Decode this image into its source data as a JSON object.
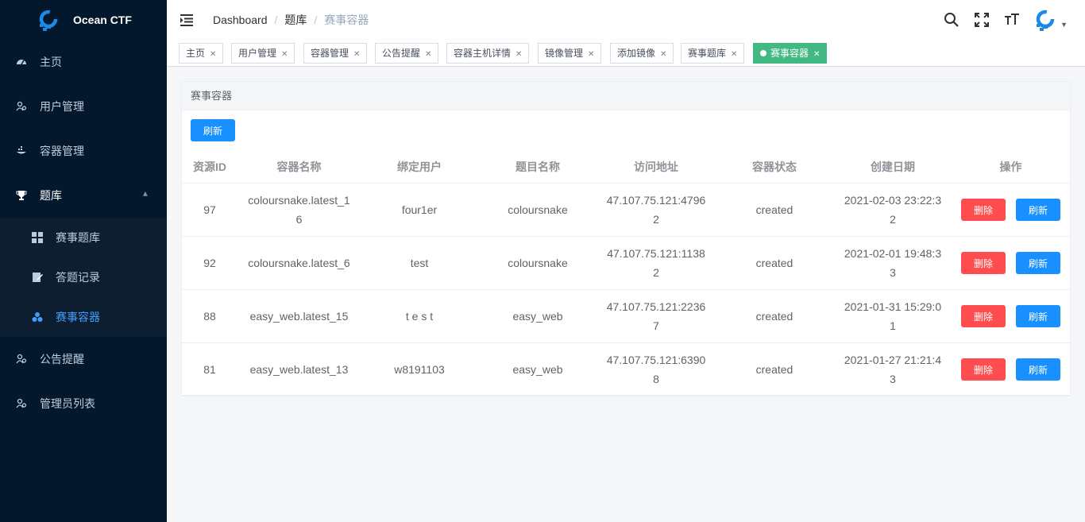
{
  "app": {
    "title": "Ocean CTF"
  },
  "sidebar": {
    "items": [
      {
        "label": "主页",
        "icon": "dashboard-icon"
      },
      {
        "label": "用户管理",
        "icon": "users-icon"
      },
      {
        "label": "容器管理",
        "icon": "container-icon"
      },
      {
        "label": "题库",
        "icon": "trophy-icon",
        "open": true,
        "children": [
          {
            "label": "赛事题库",
            "icon": "grid-icon"
          },
          {
            "label": "答题记录",
            "icon": "edit-doc-icon"
          },
          {
            "label": "赛事容器",
            "icon": "cubes-icon",
            "active": true
          }
        ]
      },
      {
        "label": "公告提醒",
        "icon": "users-icon"
      },
      {
        "label": "管理员列表",
        "icon": "users-icon"
      }
    ]
  },
  "breadcrumb": [
    "Dashboard",
    "题库",
    "赛事容器"
  ],
  "tags": [
    "主页",
    "用户管理",
    "容器管理",
    "公告提醒",
    "容器主机详情",
    "镜像管理",
    "添加镜像",
    "赛事题库",
    "赛事容器"
  ],
  "card": {
    "title": "赛事容器",
    "refresh_label": "刷新"
  },
  "table": {
    "columns": [
      "资源ID",
      "容器名称",
      "绑定用户",
      "题目名称",
      "访问地址",
      "容器状态",
      "创建日期",
      "操作"
    ],
    "rows": [
      {
        "id": "97",
        "name": "coloursnake.latest_16",
        "user": "four1er",
        "challenge": "coloursnake",
        "address": "47.107.75.121:47962",
        "status": "created",
        "created": "2021-02-03 23:22:32"
      },
      {
        "id": "92",
        "name": "coloursnake.latest_6",
        "user": "test",
        "challenge": "coloursnake",
        "address": "47.107.75.121:11382",
        "status": "created",
        "created": "2021-02-01 19:48:33"
      },
      {
        "id": "88",
        "name": "easy_web.latest_15",
        "user": "t e s t",
        "challenge": "easy_web",
        "address": "47.107.75.121:22367",
        "status": "created",
        "created": "2021-01-31 15:29:01"
      },
      {
        "id": "81",
        "name": "easy_web.latest_13",
        "user": "w8191103",
        "challenge": "easy_web",
        "address": "47.107.75.121:63908",
        "status": "created",
        "created": "2021-01-27 21:21:43"
      }
    ],
    "delete_label": "删除",
    "refresh_label": "刷新"
  },
  "colors": {
    "sidebar_bg": "#04182d",
    "active": "#409eff",
    "tag_active": "#42b983",
    "primary": "#1890ff",
    "danger": "#ff4d4f"
  }
}
